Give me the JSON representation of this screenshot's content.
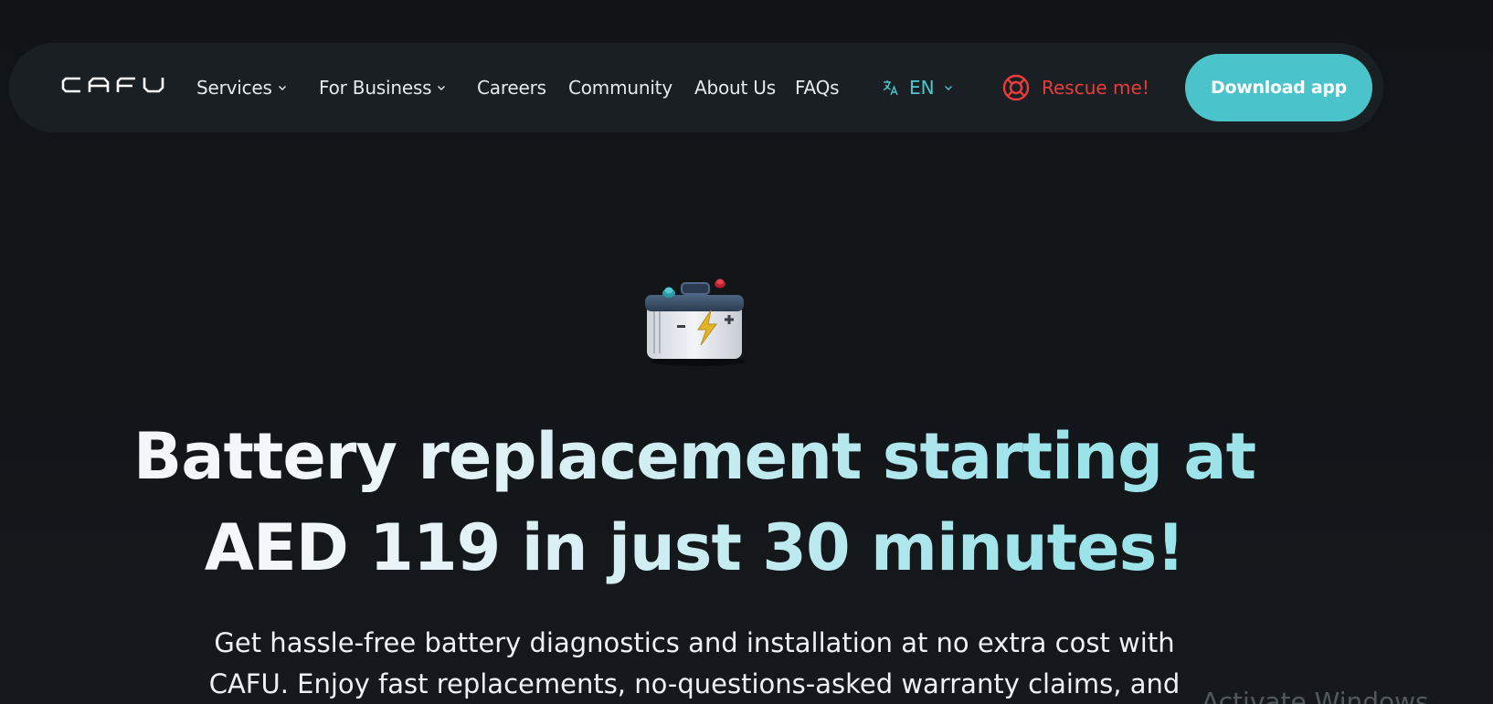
{
  "nav": {
    "logo_text": "CAFU",
    "items": [
      {
        "label": "Services",
        "has_dropdown": true
      },
      {
        "label": "For Business",
        "has_dropdown": true
      },
      {
        "label": "Careers",
        "has_dropdown": false
      },
      {
        "label": "Community",
        "has_dropdown": false
      },
      {
        "label": "About Us",
        "has_dropdown": false
      },
      {
        "label": "FAQs",
        "has_dropdown": false
      }
    ],
    "language": {
      "icon": "translate-icon",
      "label": "EN"
    },
    "rescue": {
      "icon": "lifebuoy-icon",
      "label": "Rescue me!"
    },
    "download_label": "Download app"
  },
  "hero": {
    "icon": "car-battery-icon",
    "title_line1": "Battery replacement starting at",
    "title_line2": "AED 119 in just 30 minutes!",
    "subtitle_line1": "Get hassle-free battery diagnostics and installation at no extra cost with",
    "subtitle_line2": "CAFU. Enjoy fast replacements, no-questions-asked warranty claims, and"
  },
  "overlay": {
    "watermark_text": "Activate Windows"
  },
  "colors": {
    "background": "#121518",
    "navbar": "#1a1f23",
    "accent_teal": "#4bc3cb",
    "rescue_red": "#ea3c3c",
    "title_gradient_end": "#9de3ea"
  }
}
